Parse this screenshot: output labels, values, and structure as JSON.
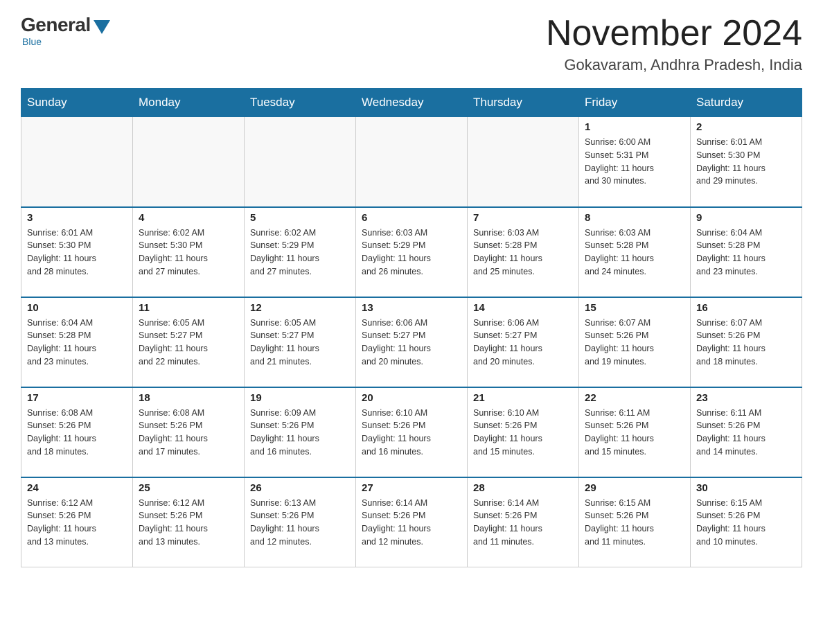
{
  "logo": {
    "general": "General",
    "blue": "Blue",
    "sub": "Blue"
  },
  "title": {
    "month": "November 2024",
    "location": "Gokavaram, Andhra Pradesh, India"
  },
  "days_of_week": [
    "Sunday",
    "Monday",
    "Tuesday",
    "Wednesday",
    "Thursday",
    "Friday",
    "Saturday"
  ],
  "weeks": [
    [
      {
        "day": "",
        "info": ""
      },
      {
        "day": "",
        "info": ""
      },
      {
        "day": "",
        "info": ""
      },
      {
        "day": "",
        "info": ""
      },
      {
        "day": "",
        "info": ""
      },
      {
        "day": "1",
        "info": "Sunrise: 6:00 AM\nSunset: 5:31 PM\nDaylight: 11 hours\nand 30 minutes."
      },
      {
        "day": "2",
        "info": "Sunrise: 6:01 AM\nSunset: 5:30 PM\nDaylight: 11 hours\nand 29 minutes."
      }
    ],
    [
      {
        "day": "3",
        "info": "Sunrise: 6:01 AM\nSunset: 5:30 PM\nDaylight: 11 hours\nand 28 minutes."
      },
      {
        "day": "4",
        "info": "Sunrise: 6:02 AM\nSunset: 5:30 PM\nDaylight: 11 hours\nand 27 minutes."
      },
      {
        "day": "5",
        "info": "Sunrise: 6:02 AM\nSunset: 5:29 PM\nDaylight: 11 hours\nand 27 minutes."
      },
      {
        "day": "6",
        "info": "Sunrise: 6:03 AM\nSunset: 5:29 PM\nDaylight: 11 hours\nand 26 minutes."
      },
      {
        "day": "7",
        "info": "Sunrise: 6:03 AM\nSunset: 5:28 PM\nDaylight: 11 hours\nand 25 minutes."
      },
      {
        "day": "8",
        "info": "Sunrise: 6:03 AM\nSunset: 5:28 PM\nDaylight: 11 hours\nand 24 minutes."
      },
      {
        "day": "9",
        "info": "Sunrise: 6:04 AM\nSunset: 5:28 PM\nDaylight: 11 hours\nand 23 minutes."
      }
    ],
    [
      {
        "day": "10",
        "info": "Sunrise: 6:04 AM\nSunset: 5:28 PM\nDaylight: 11 hours\nand 23 minutes."
      },
      {
        "day": "11",
        "info": "Sunrise: 6:05 AM\nSunset: 5:27 PM\nDaylight: 11 hours\nand 22 minutes."
      },
      {
        "day": "12",
        "info": "Sunrise: 6:05 AM\nSunset: 5:27 PM\nDaylight: 11 hours\nand 21 minutes."
      },
      {
        "day": "13",
        "info": "Sunrise: 6:06 AM\nSunset: 5:27 PM\nDaylight: 11 hours\nand 20 minutes."
      },
      {
        "day": "14",
        "info": "Sunrise: 6:06 AM\nSunset: 5:27 PM\nDaylight: 11 hours\nand 20 minutes."
      },
      {
        "day": "15",
        "info": "Sunrise: 6:07 AM\nSunset: 5:26 PM\nDaylight: 11 hours\nand 19 minutes."
      },
      {
        "day": "16",
        "info": "Sunrise: 6:07 AM\nSunset: 5:26 PM\nDaylight: 11 hours\nand 18 minutes."
      }
    ],
    [
      {
        "day": "17",
        "info": "Sunrise: 6:08 AM\nSunset: 5:26 PM\nDaylight: 11 hours\nand 18 minutes."
      },
      {
        "day": "18",
        "info": "Sunrise: 6:08 AM\nSunset: 5:26 PM\nDaylight: 11 hours\nand 17 minutes."
      },
      {
        "day": "19",
        "info": "Sunrise: 6:09 AM\nSunset: 5:26 PM\nDaylight: 11 hours\nand 16 minutes."
      },
      {
        "day": "20",
        "info": "Sunrise: 6:10 AM\nSunset: 5:26 PM\nDaylight: 11 hours\nand 16 minutes."
      },
      {
        "day": "21",
        "info": "Sunrise: 6:10 AM\nSunset: 5:26 PM\nDaylight: 11 hours\nand 15 minutes."
      },
      {
        "day": "22",
        "info": "Sunrise: 6:11 AM\nSunset: 5:26 PM\nDaylight: 11 hours\nand 15 minutes."
      },
      {
        "day": "23",
        "info": "Sunrise: 6:11 AM\nSunset: 5:26 PM\nDaylight: 11 hours\nand 14 minutes."
      }
    ],
    [
      {
        "day": "24",
        "info": "Sunrise: 6:12 AM\nSunset: 5:26 PM\nDaylight: 11 hours\nand 13 minutes."
      },
      {
        "day": "25",
        "info": "Sunrise: 6:12 AM\nSunset: 5:26 PM\nDaylight: 11 hours\nand 13 minutes."
      },
      {
        "day": "26",
        "info": "Sunrise: 6:13 AM\nSunset: 5:26 PM\nDaylight: 11 hours\nand 12 minutes."
      },
      {
        "day": "27",
        "info": "Sunrise: 6:14 AM\nSunset: 5:26 PM\nDaylight: 11 hours\nand 12 minutes."
      },
      {
        "day": "28",
        "info": "Sunrise: 6:14 AM\nSunset: 5:26 PM\nDaylight: 11 hours\nand 11 minutes."
      },
      {
        "day": "29",
        "info": "Sunrise: 6:15 AM\nSunset: 5:26 PM\nDaylight: 11 hours\nand 11 minutes."
      },
      {
        "day": "30",
        "info": "Sunrise: 6:15 AM\nSunset: 5:26 PM\nDaylight: 11 hours\nand 10 minutes."
      }
    ]
  ]
}
